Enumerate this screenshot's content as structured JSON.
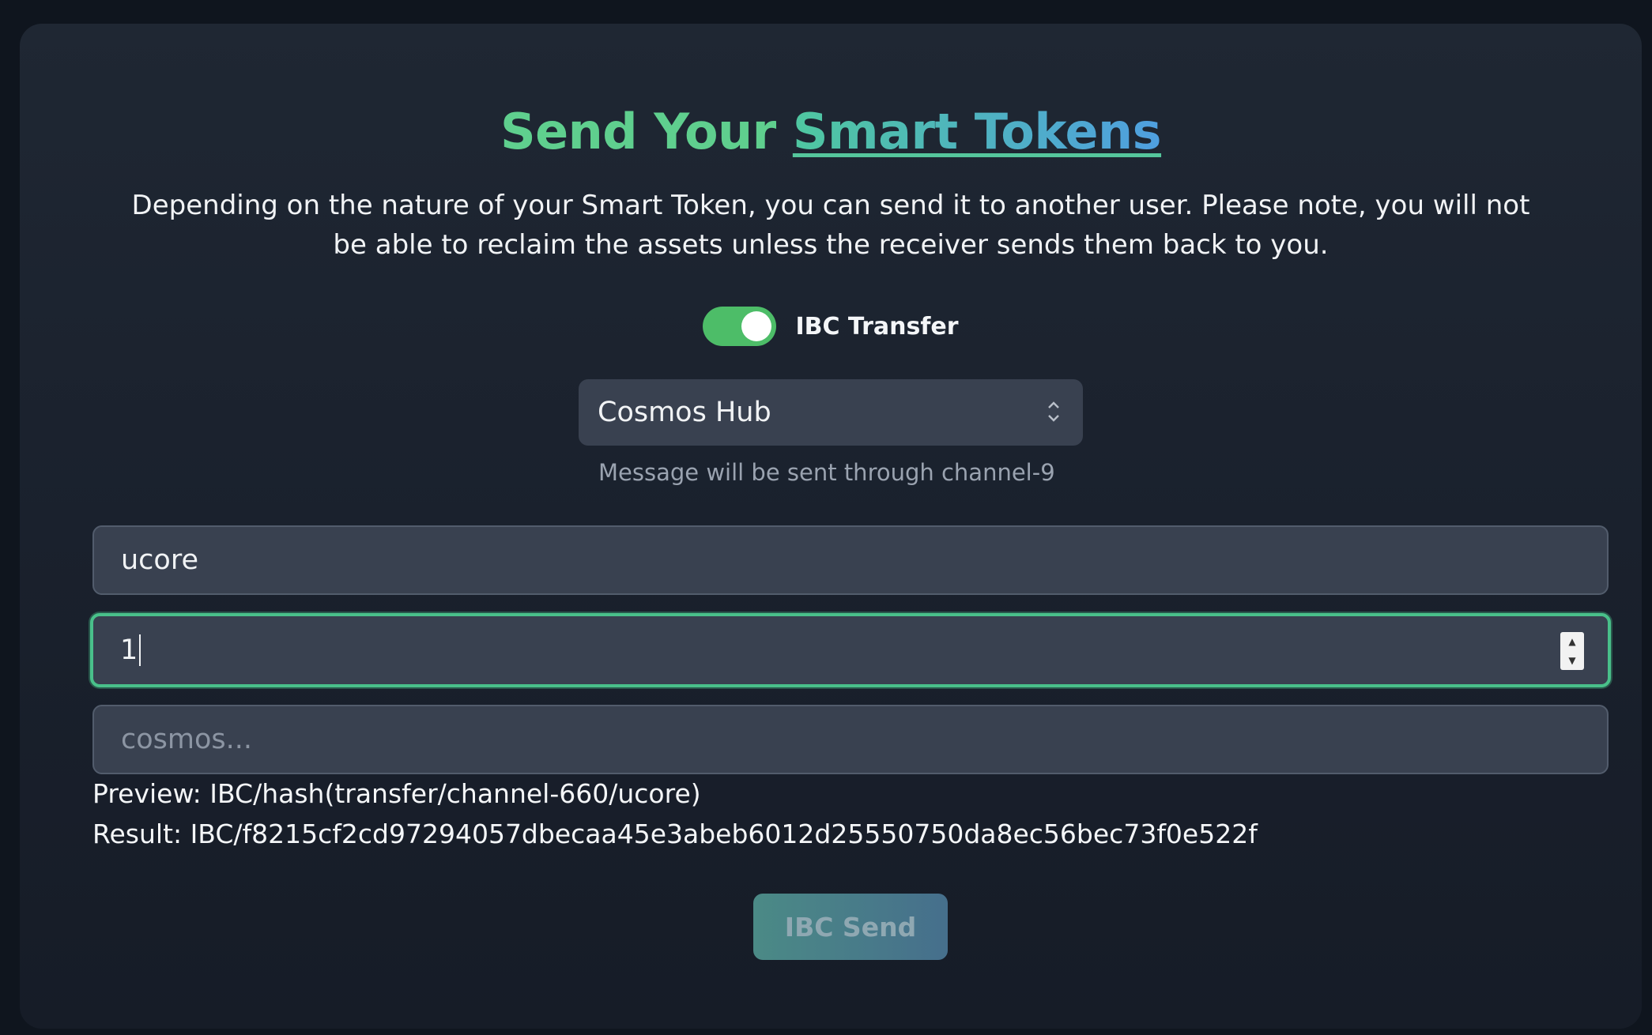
{
  "header": {
    "title_part1": "Send Your ",
    "title_part2": "Smart Tokens",
    "description": "Depending on the nature of your Smart Token, you can send it to another user. Please note, you will not be able to reclaim the assets unless the receiver sends them back to you."
  },
  "ibc_toggle": {
    "label": "IBC Transfer",
    "enabled": true
  },
  "chain_select": {
    "selected": "Cosmos Hub",
    "hint": "Message will be sent through channel-9"
  },
  "form": {
    "denom_value": "ucore",
    "amount_value": "1",
    "recipient_placeholder": "cosmos..."
  },
  "preview": {
    "preview_text": "Preview: IBC/hash(transfer/channel-660/ucore)",
    "result_text": "Result: IBC/f8215cf2cd97294057dbecaa45e3abeb6012d25550750da8ec56bec73f0e522f"
  },
  "actions": {
    "send_label": "IBC Send"
  },
  "colors": {
    "accent_green": "#5fcf8e",
    "accent_blue": "#4f9fe0",
    "toggle_on": "#4dbd68",
    "focus_border": "#49c08a"
  }
}
